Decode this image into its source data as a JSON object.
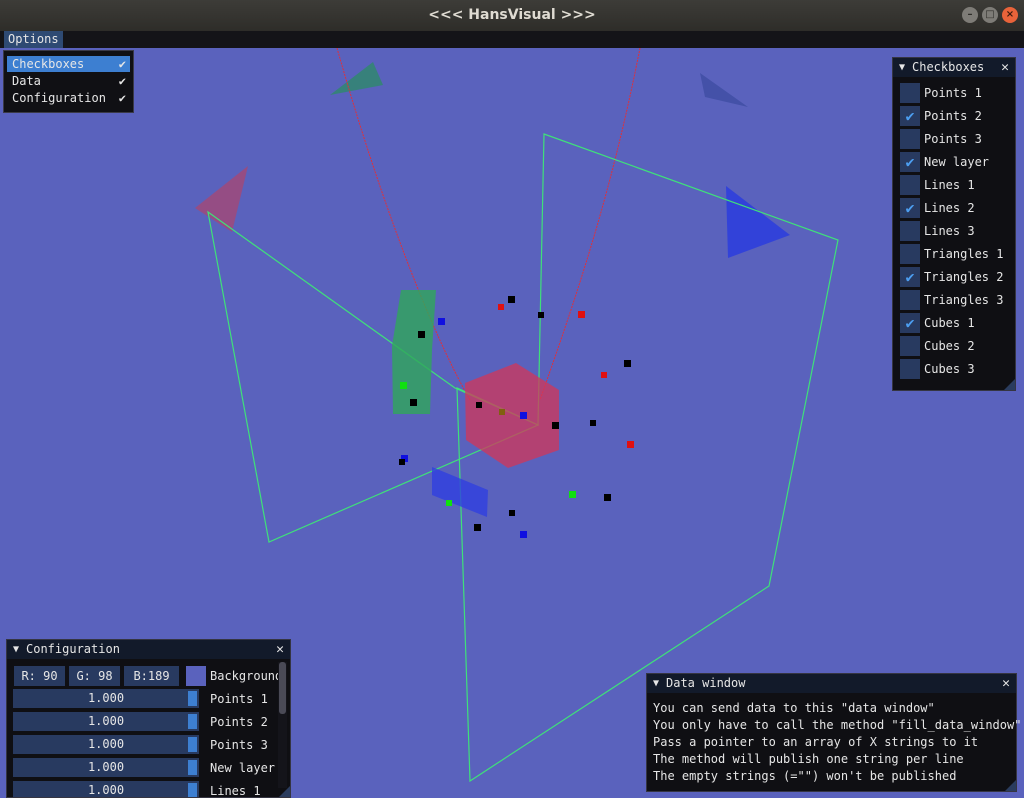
{
  "window": {
    "title": "<<<  HansVisual  >>>",
    "controls": {
      "minimize": "–",
      "maximize": "□",
      "close": "×"
    }
  },
  "menubar": {
    "options_label": "Options",
    "dropdown": [
      {
        "label": "Checkboxes",
        "checked": true,
        "selected": true
      },
      {
        "label": "Data",
        "checked": true,
        "selected": false
      },
      {
        "label": "Configuration",
        "checked": true,
        "selected": false
      }
    ]
  },
  "checkboxes_window": {
    "title": "Checkboxes",
    "items": [
      {
        "label": "Points 1",
        "checked": false
      },
      {
        "label": "Points 2",
        "checked": true
      },
      {
        "label": "Points 3",
        "checked": false
      },
      {
        "label": "New layer",
        "checked": true
      },
      {
        "label": "Lines 1",
        "checked": false
      },
      {
        "label": "Lines 2",
        "checked": true
      },
      {
        "label": "Lines 3",
        "checked": false
      },
      {
        "label": "Triangles 1",
        "checked": false
      },
      {
        "label": "Triangles 2",
        "checked": true
      },
      {
        "label": "Triangles 3",
        "checked": false
      },
      {
        "label": "Cubes 1",
        "checked": true
      },
      {
        "label": "Cubes 2",
        "checked": false
      },
      {
        "label": "Cubes 3",
        "checked": false
      }
    ]
  },
  "configuration_window": {
    "title": "Configuration",
    "color": {
      "r": "R: 90",
      "g": "G: 98",
      "b": "B:189",
      "label": "Background",
      "swatch": "#5a62bd"
    },
    "sliders": [
      {
        "value": "1.000",
        "label": "Points 1"
      },
      {
        "value": "1.000",
        "label": "Points 2"
      },
      {
        "value": "1.000",
        "label": "Points 3"
      },
      {
        "value": "1.000",
        "label": "New layer"
      },
      {
        "value": "1.000",
        "label": "Lines 1"
      }
    ]
  },
  "data_window": {
    "title": "Data window",
    "lines": [
      "You can send data to this \"data window\"",
      "You only have to call the method \"fill_data_window\"",
      "Pass a pointer to an array of X strings to it",
      "The method will publish one string per line",
      "The empty strings (=\"\") won't be published"
    ]
  },
  "colors": {
    "background": "#5a62bd",
    "accent": "#3d7fd1",
    "frame": "#283a60",
    "checkmark": "#4c9ef0"
  }
}
